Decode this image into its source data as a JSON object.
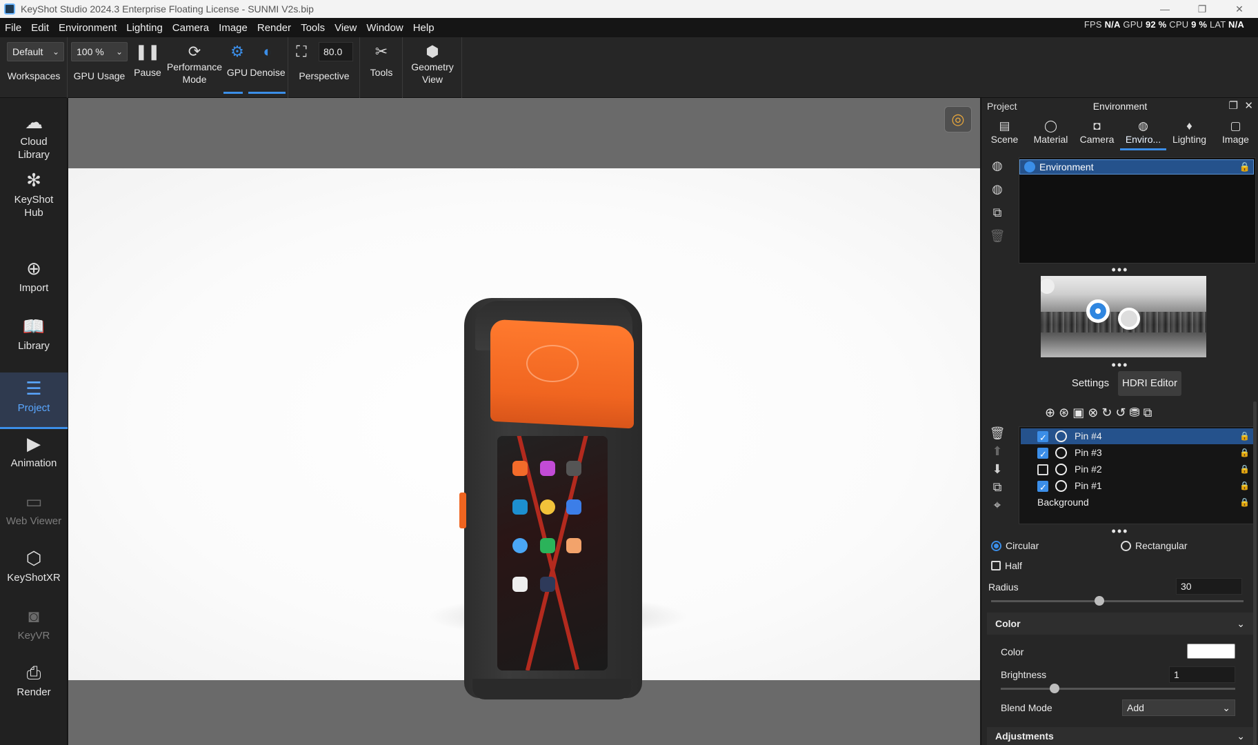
{
  "window": {
    "title": "KeyShot Studio 2024.3 Enterprise Floating License  - SUNMI V2s.bip",
    "controls": [
      "—",
      "❐",
      "✕"
    ]
  },
  "menu": [
    "File",
    "Edit",
    "Environment",
    "Lighting",
    "Camera",
    "Image",
    "Render",
    "Tools",
    "View",
    "Window",
    "Help"
  ],
  "status": {
    "fps_label": "FPS",
    "fps": "N/A",
    "gpu_label": "GPU",
    "gpu": "92 %",
    "cpu_label": "CPU",
    "cpu": "9 %",
    "lat_label": "LAT",
    "lat": "N/A"
  },
  "ribbon": {
    "workspace_value": "Default",
    "workspaces_label": "Workspaces",
    "gpu_usage_value": "100 %",
    "gpu_usage_label": "GPU Usage",
    "pause_label": "Pause",
    "performance_label_1": "Performance",
    "performance_label_2": "Mode",
    "gpu_label": "GPU",
    "denoise_label": "Denoise",
    "fov_value": "80.0",
    "perspective_label": "Perspective",
    "tools_label": "Tools",
    "geometry_label_1": "Geometry",
    "geometry_label_2": "View"
  },
  "sidebar": {
    "items": [
      {
        "label1": "Cloud",
        "label2": "Library"
      },
      {
        "label1": "KeyShot",
        "label2": "Hub"
      },
      {
        "label1": "Import"
      },
      {
        "label1": "Library"
      },
      {
        "label1": "Project"
      },
      {
        "label1": "Animation"
      },
      {
        "label1": "Web Viewer"
      },
      {
        "label1": "KeyShotXR"
      },
      {
        "label1": "KeyVR"
      },
      {
        "label1": "Render"
      }
    ]
  },
  "right_panel": {
    "project_label": "Project",
    "panel_title": "Environment",
    "tabs": [
      "Scene",
      "Material",
      "Camera",
      "Enviro...",
      "Lighting",
      "Image"
    ],
    "env_list_item": "Environment",
    "subtabs": [
      "Settings",
      "HDRI Editor"
    ],
    "pins": [
      {
        "name": "Pin #4",
        "checked": true
      },
      {
        "name": "Pin #3",
        "checked": true
      },
      {
        "name": "Pin #2",
        "checked": false
      },
      {
        "name": "Pin #1",
        "checked": true
      }
    ],
    "background_label": "Background",
    "shape": {
      "circular": "Circular",
      "rectangular": "Rectangular",
      "selected": "Circular"
    },
    "half_label": "Half",
    "radius_label": "Radius",
    "radius_value": "30",
    "radius_slider": 0.43,
    "color_section": "Color",
    "color_label": "Color",
    "color_value": "#ffffff",
    "brightness_label": "Brightness",
    "brightness_value": "1",
    "brightness_slider": 0.23,
    "blend_mode_label": "Blend Mode",
    "blend_mode_value": "Add",
    "adjustments_section": "Adjustments"
  },
  "colors": {
    "accent": "#3b8ee8",
    "device_orange": "#f06520"
  },
  "icons": {
    "pause": "pause-icon",
    "performance": "performance-icon",
    "gpu": "gpu-icon",
    "denoise": "denoise-icon",
    "perspective": "perspective-icon",
    "tools": "tools-icon",
    "geometry": "geometry-view-icon"
  }
}
